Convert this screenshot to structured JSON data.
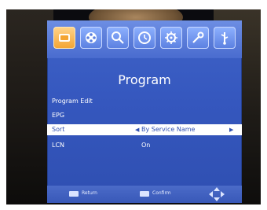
{
  "menu": {
    "icons": [
      {
        "name": "tv-icon",
        "active": true
      },
      {
        "name": "reel-icon",
        "active": false
      },
      {
        "name": "search-icon",
        "active": false
      },
      {
        "name": "clock-icon",
        "active": false
      },
      {
        "name": "gear-icon",
        "active": false
      },
      {
        "name": "tool-icon",
        "active": false
      },
      {
        "name": "usb-icon",
        "active": false
      }
    ],
    "title": "Program",
    "items": [
      {
        "label": "Program Edit",
        "value": ""
      },
      {
        "label": "EPG",
        "value": ""
      },
      {
        "label": "Sort",
        "value": "By Service Name"
      },
      {
        "label": "LCN",
        "value": "On"
      }
    ],
    "selected_index": 2
  },
  "footer": {
    "return_key": "",
    "return_label": "Return",
    "confirm_key": "",
    "confirm_label": "Confirm"
  },
  "colors": {
    "panel": "#3557be",
    "highlight": "#ffffff",
    "active_tab": "#f4a431"
  }
}
